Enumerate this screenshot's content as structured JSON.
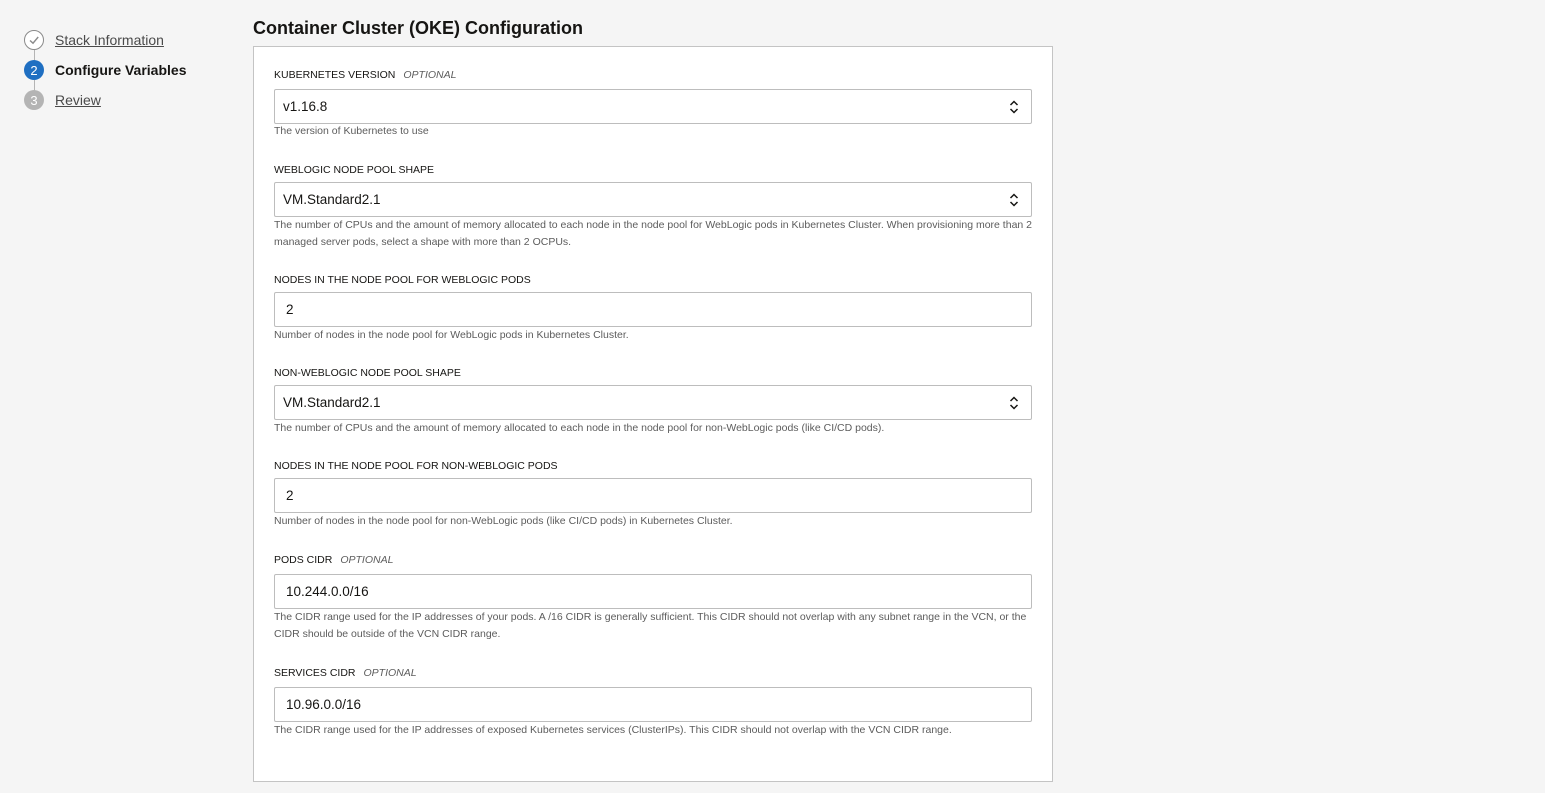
{
  "steps": [
    {
      "number": "",
      "label": "Stack Information",
      "state": "done"
    },
    {
      "number": "2",
      "label": "Configure Variables",
      "state": "current"
    },
    {
      "number": "3",
      "label": "Review",
      "state": "pending"
    }
  ],
  "section": {
    "title": "Container Cluster (OKE) Configuration"
  },
  "fields": {
    "kubernetes_version": {
      "label": "KUBERNETES VERSION",
      "optional": "OPTIONAL",
      "value": "v1.16.8",
      "help": "The version of Kubernetes to use"
    },
    "weblogic_node_pool_shape": {
      "label": "WEBLOGIC NODE POOL SHAPE",
      "value": "VM.Standard2.1",
      "help": "The number of CPUs and the amount of memory allocated to each node in the node pool for WebLogic pods in Kubernetes Cluster. When provisioning more than 2 managed server pods, select a shape with more than 2 OCPUs."
    },
    "weblogic_node_count": {
      "label": "NODES IN THE NODE POOL FOR WEBLOGIC PODS",
      "value": "2",
      "help": "Number of nodes in the node pool for WebLogic pods in Kubernetes Cluster."
    },
    "non_weblogic_node_pool_shape": {
      "label": "NON-WEBLOGIC NODE POOL SHAPE",
      "value": "VM.Standard2.1",
      "help": "The number of CPUs and the amount of memory allocated to each node in the node pool for non-WebLogic pods (like CI/CD pods)."
    },
    "non_weblogic_node_count": {
      "label": "NODES IN THE NODE POOL FOR NON-WEBLOGIC PODS",
      "value": "2",
      "help": "Number of nodes in the node pool for non-WebLogic pods (like CI/CD pods) in Kubernetes Cluster."
    },
    "pods_cidr": {
      "label": "PODS CIDR",
      "optional": "OPTIONAL",
      "value": "10.244.0.0/16",
      "help": "The CIDR range used for the IP addresses of your pods. A /16 CIDR is generally sufficient. This CIDR should not overlap with any subnet range in the VCN, or the CIDR should be outside of the VCN CIDR range."
    },
    "services_cidr": {
      "label": "SERVICES CIDR",
      "optional": "OPTIONAL",
      "value": "10.96.0.0/16",
      "help": "The CIDR range used for the IP addresses of exposed Kubernetes services (ClusterIPs). This CIDR should not overlap with the VCN CIDR range."
    }
  },
  "icons": {
    "done": "check-icon",
    "select": "chevron-up-down-icon"
  },
  "colors": {
    "accent": "#1f6fc2",
    "pending": "#b4b4b4",
    "background": "#f5f5f5"
  }
}
